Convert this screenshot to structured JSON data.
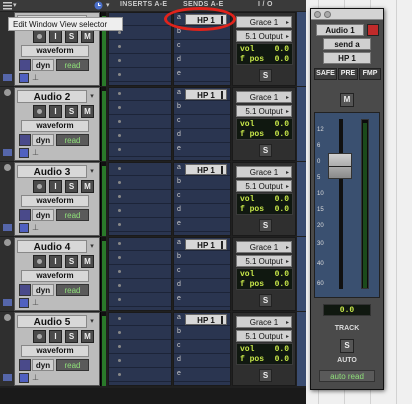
{
  "header": {
    "col_inserts": "INSERTS A-E",
    "col_sends": "SENDS A-E",
    "col_io": "I / O"
  },
  "tooltip": "Edit Window View selector",
  "tracks": [
    {
      "name": "",
      "send_a": "HP 1",
      "input": "Grace 1",
      "output": "5.1 Output",
      "vol": "0.0",
      "fpos": "0.0",
      "view": "waveform",
      "dyn": "dyn",
      "auto": "read"
    },
    {
      "name": "Audio 2",
      "send_a": "HP 1",
      "input": "Grace 1",
      "output": "5.1 Output",
      "vol": "0.0",
      "fpos": "0.0",
      "view": "waveform",
      "dyn": "dyn",
      "auto": "read"
    },
    {
      "name": "Audio 3",
      "send_a": "HP 1",
      "input": "Grace 1",
      "output": "5.1 Output",
      "vol": "0.0",
      "fpos": "0.0",
      "view": "waveform",
      "dyn": "dyn",
      "auto": "read"
    },
    {
      "name": "Audio 4",
      "send_a": "HP 1",
      "input": "Grace 1",
      "output": "5.1 Output",
      "vol": "0.0",
      "fpos": "0.0",
      "view": "waveform",
      "dyn": "dyn",
      "auto": "read"
    },
    {
      "name": "Audio 5",
      "send_a": "HP 1",
      "input": "Grace 1",
      "output": "5.1 Output",
      "vol": "0.0",
      "fpos": "0.0",
      "view": "waveform",
      "dyn": "dyn",
      "auto": "read"
    }
  ],
  "labels": {
    "slot_a": "a",
    "slot_b": "b",
    "slot_c": "c",
    "slot_d": "d",
    "slot_e": "e",
    "rec": "",
    "input_mon": "I",
    "solo": "S",
    "mute": "M",
    "vol": "vol",
    "fpos": "f pos"
  },
  "output_window": {
    "track": "Audio 1",
    "send": "send a",
    "path": "HP 1",
    "safe": "SAFE",
    "pre": "PRE",
    "fmp": "FMP",
    "mute": "M",
    "scale": [
      "12",
      "6",
      "0",
      "5",
      "10",
      "15",
      "20",
      "30",
      "40",
      "60"
    ],
    "vol": "0.0",
    "track_label": "TRACK",
    "solo": "S",
    "auto_label": "AUTO",
    "auto_mode": "auto read"
  },
  "colors": {
    "highlight_circle": "#e0231b",
    "read_green": "#8fe07a",
    "vol_yellow": "#c8e84a",
    "insert_blue": "#2a3550"
  }
}
